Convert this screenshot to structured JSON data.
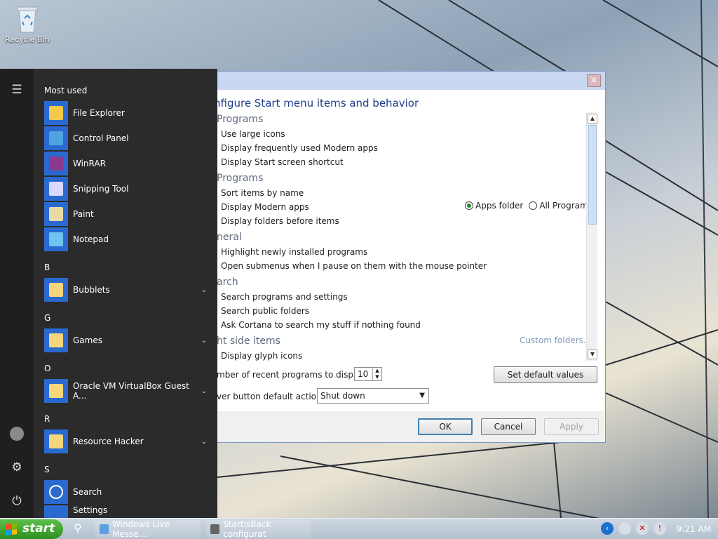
{
  "desktop": {
    "recycle_bin_label": "Recycle Bin"
  },
  "dialog": {
    "close_symbol": "×",
    "heading": "nfigure Start menu items and behavior",
    "sections": [
      {
        "title": "Programs",
        "items": [
          "Use large icons",
          "Display frequently used Modern apps",
          "Display Start screen shortcut"
        ]
      },
      {
        "title": "Programs",
        "items": [
          "Sort items by name",
          "Display Modern apps",
          "Display folders before items"
        ]
      },
      {
        "title": "neral",
        "items": [
          "Highlight newly installed programs",
          "Open submenus when I pause on them with the mouse pointer"
        ]
      },
      {
        "title": "arch",
        "items": [
          "Search programs and settings",
          "Search public folders",
          "Ask Cortana to search my stuff if nothing found"
        ]
      },
      {
        "title": "ht side items",
        "items": [
          "Display glyph icons"
        ]
      }
    ],
    "modern_apps_options": [
      {
        "label": "Apps folder",
        "selected": true
      },
      {
        "label": "All Programs",
        "selected": false
      }
    ],
    "custom_folders_link": "Custom folders...",
    "recent_programs_label": "mber of recent programs to display:",
    "recent_programs_value": "10",
    "power_button_label": "ver button default action:",
    "power_button_value": "Shut down",
    "set_default_label": "Set default values",
    "ok_label": "OK",
    "cancel_label": "Cancel",
    "apply_label": "Apply"
  },
  "start_menu": {
    "most_used_label": "Most used",
    "most_used": [
      {
        "label": "File Explorer",
        "icon": "folder-icon",
        "color": "#f3c94a"
      },
      {
        "label": "Control Panel",
        "icon": "control-panel-icon",
        "color": "#4fa3e0"
      },
      {
        "label": "WinRAR",
        "icon": "winrar-icon",
        "color": "#8a3b8f"
      },
      {
        "label": "Snipping Tool",
        "icon": "scissors-icon",
        "color": "#d9d9ff"
      },
      {
        "label": "Paint",
        "icon": "palette-icon",
        "color": "#e9d9a6"
      },
      {
        "label": "Notepad",
        "icon": "notepad-icon",
        "color": "#6fc3f0"
      }
    ],
    "groups": [
      {
        "letter": "B",
        "label": "Bubblets"
      },
      {
        "letter": "G",
        "label": "Games"
      },
      {
        "letter": "O",
        "label": "Oracle VM VirtualBox Guest A..."
      },
      {
        "letter": "R",
        "label": "Resource Hacker"
      }
    ],
    "s_letter": "S",
    "search_label": "Search",
    "settings_label": "Settings"
  },
  "taskbar": {
    "start_label": "start",
    "tasks": [
      {
        "label": "Windows Live Messe...",
        "icon_color": "#5aa0e0"
      },
      {
        "label": "StartIsBack configurat",
        "icon_color": "#666666"
      }
    ],
    "clock": "9:21 AM"
  }
}
